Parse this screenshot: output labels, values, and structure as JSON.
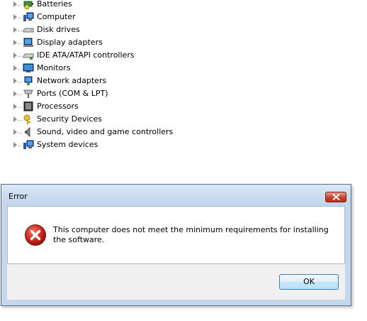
{
  "device_tree": {
    "items": [
      {
        "label": "Batteries",
        "icon": "battery-icon"
      },
      {
        "label": "Computer",
        "icon": "computer-icon"
      },
      {
        "label": "Disk drives",
        "icon": "disk-drive-icon"
      },
      {
        "label": "Display adapters",
        "icon": "display-adapter-icon"
      },
      {
        "label": "IDE ATA/ATAPI controllers",
        "icon": "ide-controller-icon"
      },
      {
        "label": "Monitors",
        "icon": "monitor-icon"
      },
      {
        "label": "Network adapters",
        "icon": "network-adapter-icon"
      },
      {
        "label": "Ports (COM & LPT)",
        "icon": "port-icon"
      },
      {
        "label": "Processors",
        "icon": "processor-icon"
      },
      {
        "label": "Security Devices",
        "icon": "security-key-icon"
      },
      {
        "label": "Sound, video and game controllers",
        "icon": "speaker-icon"
      },
      {
        "label": "System devices",
        "icon": "system-devices-icon"
      }
    ]
  },
  "dialog": {
    "title": "Error",
    "message": "This computer does not meet the minimum requirements for installing the software.",
    "ok_label": "OK",
    "icon": "error-icon",
    "colors": {
      "error_red": "#c8241b",
      "close_red": "#c6412c",
      "button_border": "#3c7fb1"
    }
  }
}
